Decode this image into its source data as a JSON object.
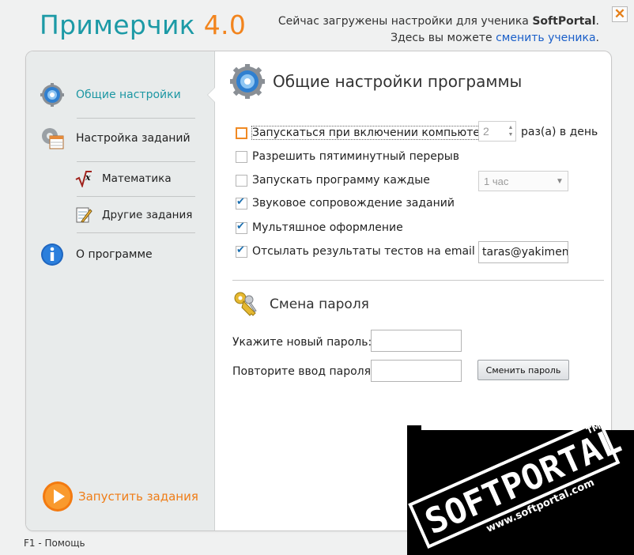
{
  "header": {
    "app_name": "Примерчик",
    "app_version": "4.0",
    "info_line1_prefix": "Сейчас загружены настройки для ученика ",
    "info_line1_user": "SoftPortal",
    "info_line1_suffix": ".",
    "info_line2_prefix": "Здесь вы можете ",
    "info_line2_link": "сменить ученика",
    "info_line2_suffix": ".",
    "close_label": "✕"
  },
  "sidebar": {
    "items": [
      {
        "label": "Общие настройки",
        "icon": "gear-globe-icon",
        "active": true
      },
      {
        "label": "Настройка заданий",
        "icon": "gear-table-icon"
      },
      {
        "label": "Математика",
        "icon": "sqrt-x-icon"
      },
      {
        "label": "Другие задания",
        "icon": "notepad-pencil-icon"
      },
      {
        "label": "О программе",
        "icon": "info-icon"
      }
    ],
    "run_label": "Запустить задания"
  },
  "general": {
    "title": "Общие настройки программы",
    "options": [
      {
        "label": "Запускаться при включении компьютера",
        "checked": false
      },
      {
        "label": "Разрешить пятиминутный перерыв",
        "checked": false
      },
      {
        "label": "Запускать программу каждые",
        "checked": false
      },
      {
        "label": "Звуковое сопровождение заданий",
        "checked": true
      },
      {
        "label": "Мультяшное оформление",
        "checked": true
      },
      {
        "label": "Отсылать результаты тестов на email",
        "checked": true
      }
    ],
    "times_value": "2",
    "times_suffix": "раз(а) в день",
    "interval_value": "1 час",
    "email_value": "taras@yakimenko"
  },
  "password": {
    "title": "Смена пароля",
    "new_label": "Укажите новый пароль:",
    "repeat_label": "Повторите ввод пароля:",
    "change_button": "Сменить пароль"
  },
  "footer": {
    "help": "F1 - Помощь"
  },
  "watermark": {
    "brand": "SOFTPORTAL",
    "tm": "TM",
    "url": "www.softportal.com"
  },
  "colors": {
    "accent_teal": "#1c9aa6",
    "accent_orange": "#f2841d",
    "link": "#1a5fc9"
  }
}
